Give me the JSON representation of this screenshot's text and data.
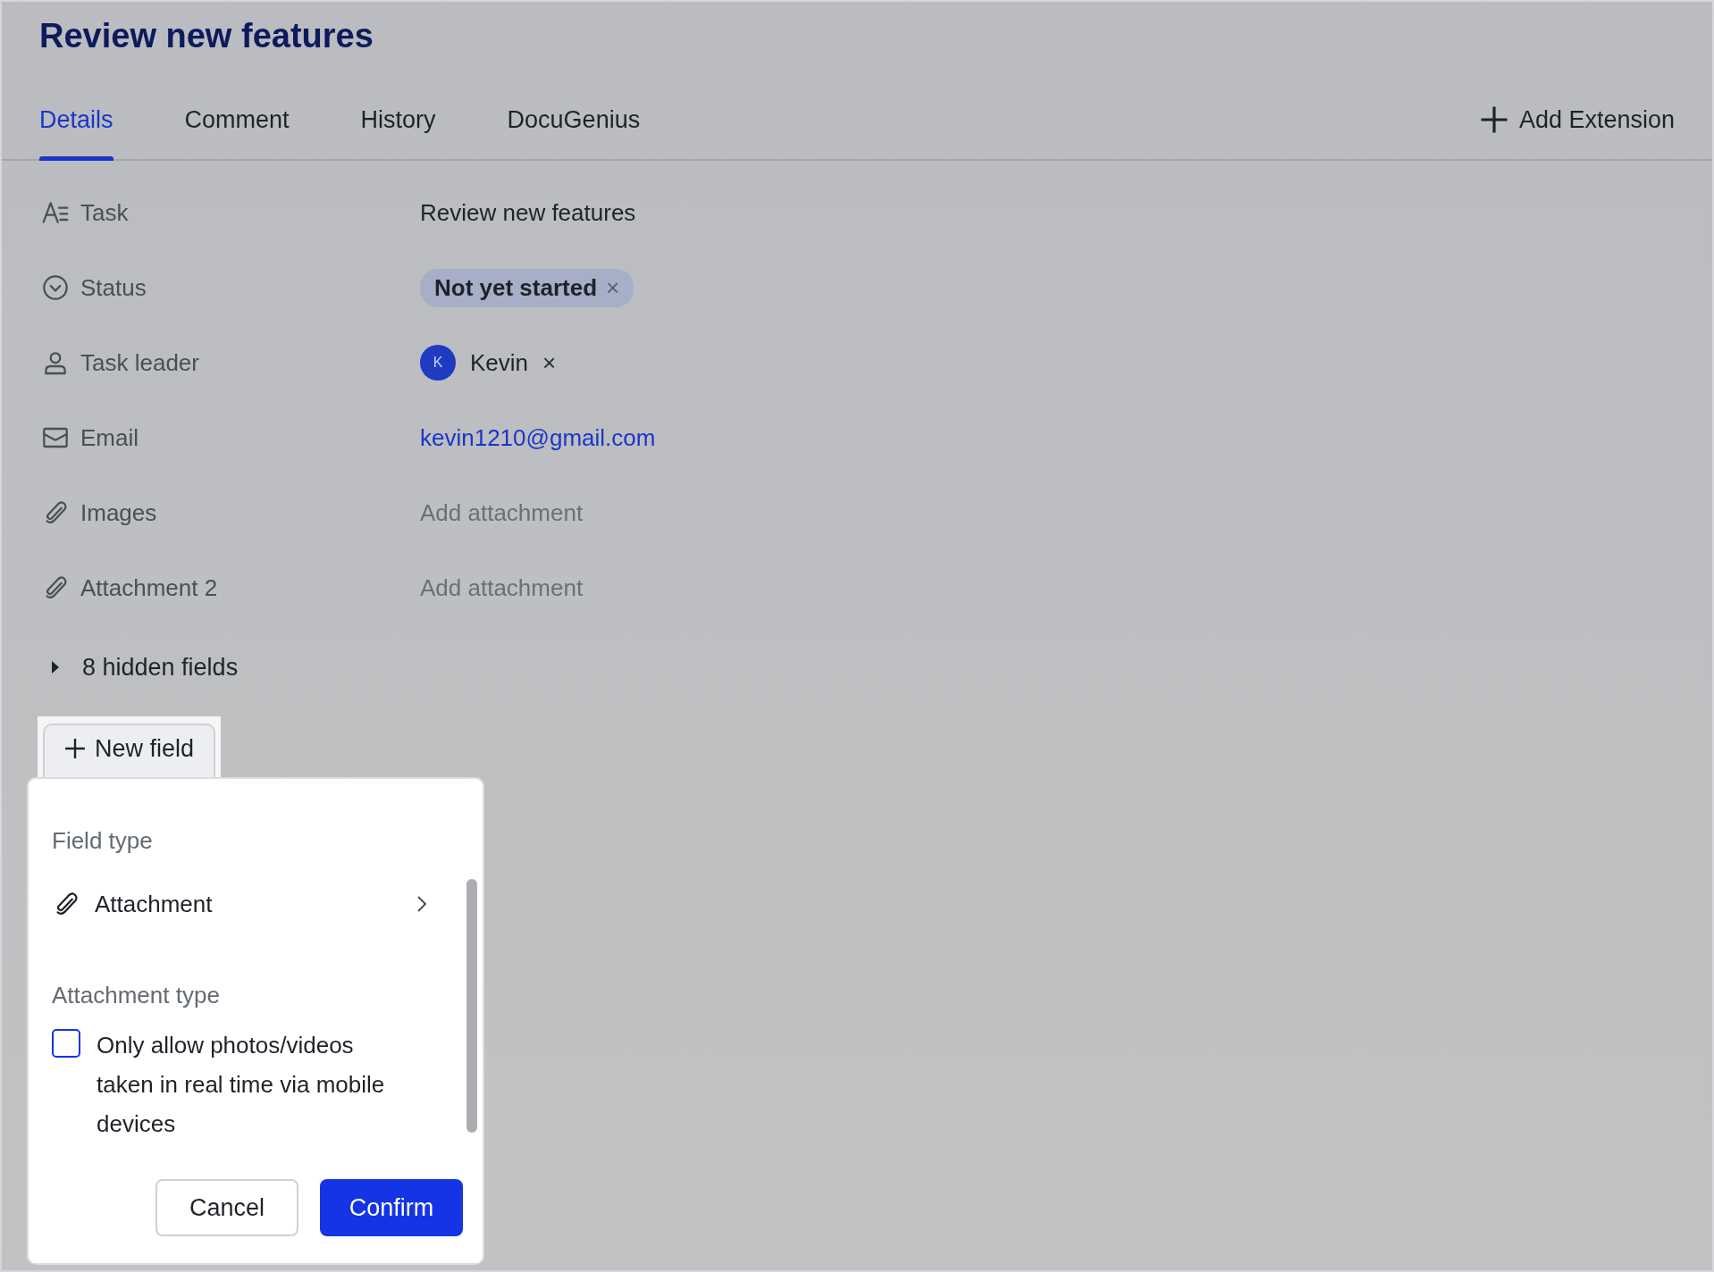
{
  "title": "Review new features",
  "tabs": [
    {
      "label": "Details",
      "selected": true
    },
    {
      "label": "Comment",
      "selected": false
    },
    {
      "label": "History",
      "selected": false
    },
    {
      "label": "DocuGenius",
      "selected": false
    }
  ],
  "add_extension": "Add Extension",
  "fields": [
    {
      "label": "Task",
      "kind": "text",
      "value": "Review new features"
    },
    {
      "label": "Status",
      "kind": "tag",
      "value": "Not yet started",
      "remove": "×"
    },
    {
      "label": "Task leader",
      "kind": "person",
      "avatar": "K",
      "value": "Kevin",
      "remove": "×"
    },
    {
      "label": "Email",
      "kind": "link",
      "value": "kevin1210@gmail.com"
    },
    {
      "label": "Images",
      "kind": "placeholder",
      "value": "Add attachment"
    },
    {
      "label": "Attachment 2",
      "kind": "placeholder",
      "value": "Add attachment"
    }
  ],
  "hidden_fields": {
    "label": "8 hidden fields",
    "expanded": false
  },
  "new_field_button": "New field",
  "popup": {
    "field_type_label": "Field type",
    "field_type": "Attachment",
    "attachment_type_label": "Attachment type",
    "option": {
      "label": "Only allow photos/videos taken in real time via mobile devices",
      "checked": false
    },
    "buttons": [
      {
        "label": "Cancel",
        "kind": "secondary"
      },
      {
        "label": "Confirm",
        "kind": "primary"
      }
    ]
  }
}
